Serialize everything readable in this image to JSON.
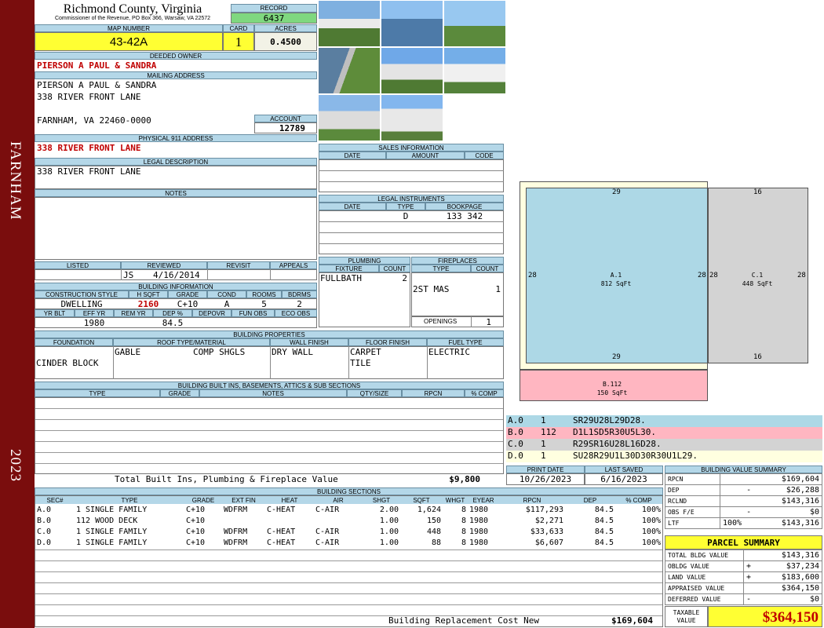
{
  "side": {
    "town": "FARNHAM",
    "year": "2023"
  },
  "header": {
    "county": "Richmond County, Virginia",
    "commissioner": "Commissioner of the Revenue, PO Box 366, Warsaw, VA 22572",
    "record_label": "RECORD",
    "record": "6437",
    "map_label": "MAP NUMBER",
    "map": "43-42A",
    "card_label": "CARD",
    "card": "1",
    "acres_label": "ACRES",
    "acres": "0.4500"
  },
  "owner": {
    "label": "DEEDED OWNER",
    "name": "PIERSON A PAUL & SANDRA"
  },
  "mailing": {
    "label": "MAILING ADDRESS",
    "line1": "PIERSON A PAUL & SANDRA",
    "line2": "338 RIVER FRONT LANE",
    "line3": "FARNHAM, VA 22460-0000",
    "account_label": "ACCOUNT",
    "account": "12789"
  },
  "physical": {
    "label": "PHYSICAL 911 ADDRESS",
    "value": "338 RIVER FRONT LANE"
  },
  "legal": {
    "label": "LEGAL DESCRIPTION",
    "value": "338 RIVER FRONT LANE"
  },
  "notes": {
    "label": "NOTES"
  },
  "review": {
    "listed": "LISTED",
    "reviewed": "REVIEWED",
    "revisit": "REVISIT",
    "appeals": "APPEALS",
    "reviewer": "JS",
    "date": "4/16/2014"
  },
  "bldg": {
    "label": "BUILDING INFORMATION",
    "h_style": "CONSTRUCTION STYLE",
    "h_sqft": "H SQFT",
    "h_grade": "GRADE",
    "h_cond": "COND",
    "h_rooms": "ROOMS",
    "h_bdrms": "BDRMS",
    "style": "DWELLING",
    "sqft": "2160",
    "grade": "C+10",
    "cond": "A",
    "rooms": "5",
    "bdrms": "2",
    "h_yrblt": "YR BLT",
    "h_effyr": "EFF YR",
    "h_remyr": "REM YR",
    "h_dep": "DEP %",
    "h_depovr": "DEPOVR",
    "h_funobs": "FUN OBS",
    "h_ecoobs": "ECO OBS",
    "effyr": "1980",
    "dep": "84.5"
  },
  "sales": {
    "label": "SALES INFORMATION",
    "date": "DATE",
    "amount": "AMOUNT",
    "code": "CODE"
  },
  "instruments": {
    "label": "LEGAL INSTRUMENTS",
    "date": "DATE",
    "type": "TYPE",
    "book": "BOOKPAGE",
    "r_type": "D",
    "r_book": "133 342"
  },
  "plumbing": {
    "label": "PLUMBING",
    "fixture": "FIXTURE",
    "count": "COUNT",
    "r_fixture": "FULLBATH",
    "r_count": "2"
  },
  "fireplaces": {
    "label": "FIREPLACES",
    "type": "TYPE",
    "count": "COUNT",
    "r_type": "2ST MAS",
    "r_count": "1",
    "openings_label": "OPENINGS",
    "openings": "1"
  },
  "props": {
    "label": "BUILDING PROPERTIES",
    "h_found": "FOUNDATION",
    "h_roof": "ROOF TYPE/MATERIAL",
    "h_wall": "WALL FINISH",
    "h_floor": "FLOOR FINISH",
    "h_fuel": "FUEL TYPE",
    "found": "CINDER BLOCK",
    "roof1": "GABLE",
    "roof2": "COMP SHGLS",
    "wall": "DRY WALL",
    "floor1": "CARPET",
    "floor2": "TILE",
    "fuel": "ELECTRIC"
  },
  "builtins": {
    "label": "BUILDING BUILT INS, BASEMENTS, ATTICS & SUB SECTIONS",
    "type": "TYPE",
    "grade": "GRADE",
    "notes": "NOTES",
    "qty": "QTY/SIZE",
    "rpcn": "RPCN",
    "pct": "% COMP",
    "total_label": "Total Built Ins, Plumbing & Fireplace Value",
    "total": "$9,800"
  },
  "dates": {
    "print_label": "PRINT DATE",
    "saved_label": "LAST SAVED",
    "print": "10/26/2023",
    "saved": "6/16/2023"
  },
  "sketch": {
    "a_top": "29",
    "a_left": "28",
    "a_right": "28",
    "a_bottom": "29",
    "a_name": "A.1",
    "a_area": "812 SqFt",
    "c_top": "16",
    "c_left": "28",
    "c_right": "28",
    "c_bottom": "16",
    "c_name": "C.1",
    "c_area": "448 SqFt",
    "b_name": "B.112",
    "b_area": "150 SqFt",
    "color_a": "#add8e6",
    "color_b": "#ffb6c1",
    "color_c": "#d3d3d3",
    "color_d": "#ffffe0"
  },
  "sketch_codes": [
    {
      "id": "A.0",
      "n": "1",
      "code": "SR29U28L29D28."
    },
    {
      "id": "B.0",
      "n": "112",
      "code": "D1L1SD5R30U5L30."
    },
    {
      "id": "C.0",
      "n": "1",
      "code": "R29SR16U28L16D28."
    },
    {
      "id": "D.0",
      "n": "1",
      "code": "SU28R29U1L30D30R30U1L29."
    }
  ],
  "sections": {
    "label": "BUILDING SECTIONS",
    "headers": [
      "SEC#",
      "TYPE",
      "GRADE",
      "EXT FIN",
      "HEAT",
      "AIR",
      "SHGT",
      "SQFT",
      "WHGT",
      "EYEAR",
      "RPCN",
      "DEP",
      "% COMP"
    ],
    "rows": [
      [
        "A.0",
        "1 SINGLE FAMILY",
        "C+10",
        "WDFRM",
        "C-HEAT",
        "C-AIR",
        "2.00",
        "1,624",
        "8",
        "1980",
        "$117,293",
        "84.5",
        "100%"
      ],
      [
        "B.0",
        "112 WOOD DECK",
        "C+10",
        "",
        "",
        "",
        "1.00",
        "150",
        "8",
        "1980",
        "$2,271",
        "84.5",
        "100%"
      ],
      [
        "C.0",
        "1 SINGLE FAMILY",
        "C+10",
        "WDFRM",
        "C-HEAT",
        "C-AIR",
        "1.00",
        "448",
        "8",
        "1980",
        "$33,633",
        "84.5",
        "100%"
      ],
      [
        "D.0",
        "1 SINGLE FAMILY",
        "C+10",
        "WDFRM",
        "C-HEAT",
        "C-AIR",
        "1.00",
        "88",
        "8",
        "1980",
        "$6,607",
        "84.5",
        "100%"
      ]
    ],
    "replacement_label": "Building Replacement Cost New",
    "replacement": "$169,604"
  },
  "bvs": {
    "label": "BUILDING VALUE SUMMARY",
    "rows": [
      {
        "k": "RPCN",
        "s": "",
        "v": "$169,604"
      },
      {
        "k": "DEP",
        "s": "-",
        "v": "$26,288"
      },
      {
        "k": "RCLND",
        "s": "",
        "v": "$143,316"
      },
      {
        "k": "OBS F/E",
        "s": "-",
        "v": "$0"
      },
      {
        "k": "LTF",
        "pct": "100%",
        "s": "",
        "v": "$143,316"
      }
    ]
  },
  "parcel": {
    "label": "PARCEL SUMMARY",
    "rows": [
      {
        "k": "TOTAL BLDG VALUE",
        "s": "",
        "v": "$143,316"
      },
      {
        "k": "OBLDG VALUE",
        "s": "+",
        "v": "$37,234"
      },
      {
        "k": "LAND VALUE",
        "s": "+",
        "v": "$183,600"
      },
      {
        "k": "APPRAISED VALUE",
        "s": "",
        "v": "$364,150"
      },
      {
        "k": "DEFERRED VALUE",
        "s": "-",
        "v": "$0"
      }
    ],
    "taxable_label1": "TAXABLE",
    "taxable_label2": "VALUE",
    "taxable": "$364,150"
  }
}
